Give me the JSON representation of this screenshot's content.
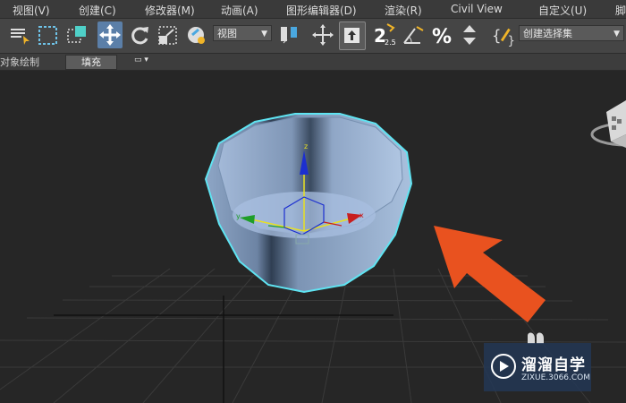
{
  "menu": {
    "items": [
      "视图(V)",
      "创建(C)",
      "修改器(M)",
      "动画(A)",
      "图形编辑器(D)",
      "渲染(R)",
      "Civil View",
      "自定义(U)",
      "脚"
    ]
  },
  "toolbar": {
    "view_dropdown": "视图",
    "selection_set_dropdown": "创建选择集",
    "snap_value": "2.5",
    "icons": [
      "scene-explorer-icon",
      "select-region-icon",
      "window-crossing-icon",
      "move-icon",
      "rotate-icon",
      "scale-icon",
      "selection-filter-icon",
      "pivot-icon",
      "transform-gizmo-icon",
      "keyboard-shortcut-icon",
      "snap-toggle-icon",
      "angle-snap-icon",
      "percent-snap-icon",
      "spinner-snap-icon",
      "named-selection-icon"
    ],
    "accent_color": "#5b7fa8"
  },
  "ribbon": {
    "label": "对象绘制",
    "fill_button": "填充"
  },
  "viewport": {
    "object": "bowl",
    "selection_color": "#5fe4f2",
    "object_color": "#9db6d8",
    "arrow_color": "#e9521f",
    "axis_labels": {
      "x": "x",
      "y": "y",
      "z": "z"
    }
  },
  "watermark": {
    "name": "溜溜自学",
    "url": "ZIXUE.3066.COM"
  }
}
